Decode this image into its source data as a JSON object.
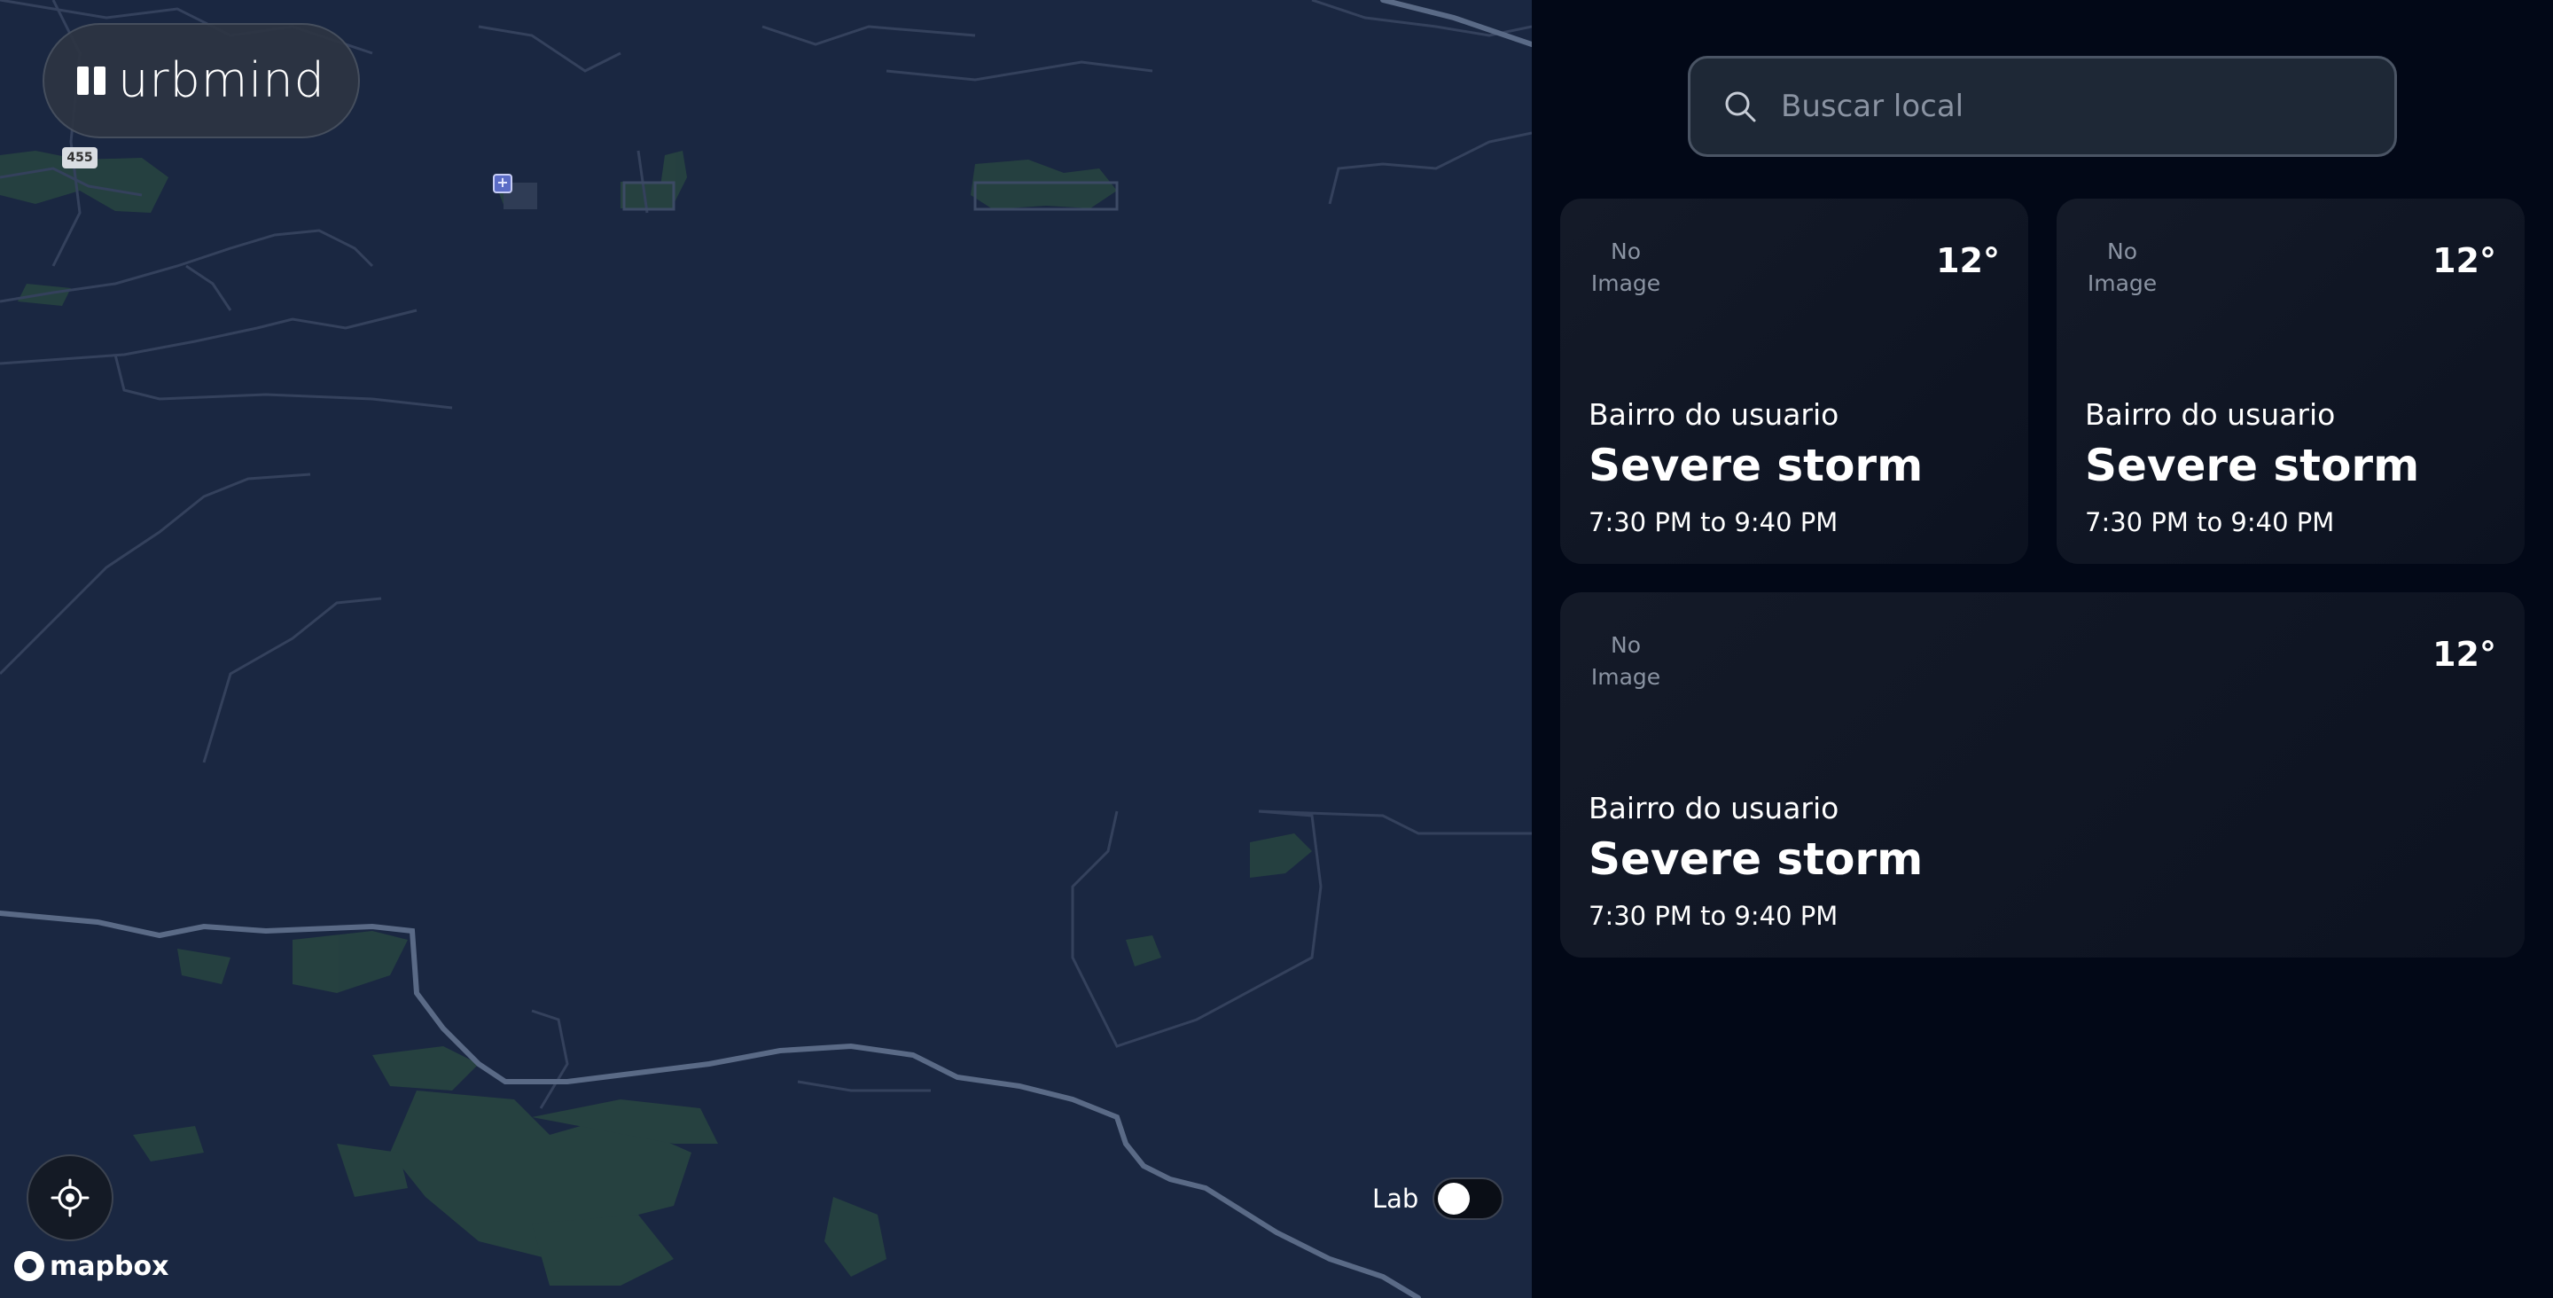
{
  "brand": {
    "name": "urbmind"
  },
  "map": {
    "route_shield": "455",
    "hospital_icon": "hospital-icon",
    "locate_icon": "crosshair-icon",
    "attribution": "mapbox",
    "lab_toggle": {
      "label": "Lab",
      "enabled": false
    }
  },
  "search": {
    "placeholder": "Buscar local",
    "value": "",
    "icon": "search-icon"
  },
  "cards": [
    {
      "image_text": "No Image",
      "temperature": "12°",
      "neighborhood": "Bairro do usuario",
      "title": "Severe storm",
      "time": "7:30 PM to 9:40 PM"
    },
    {
      "image_text": "No Image",
      "temperature": "12°",
      "neighborhood": "Bairro do usuario",
      "title": "Severe storm",
      "time": "7:30 PM to 9:40 PM"
    },
    {
      "image_text": "No Image",
      "temperature": "12°",
      "neighborhood": "Bairro do usuario",
      "title": "Severe storm",
      "time": "7:30 PM to 9:40 PM"
    }
  ],
  "colors": {
    "map_background": "#1a2741",
    "sidebar_background": "#020817",
    "card_background": "#111827",
    "road": "#3b4a66",
    "highway": "#5a6a86",
    "vegetation": "#2a4a40"
  }
}
